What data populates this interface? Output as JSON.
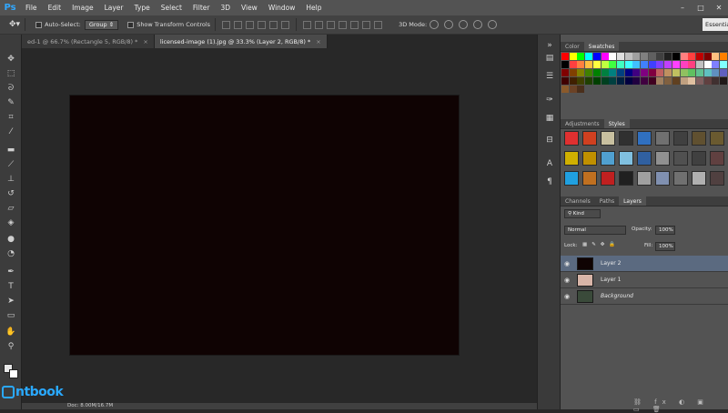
{
  "app": {
    "logo": "Ps"
  },
  "menu": [
    "File",
    "Edit",
    "Image",
    "Layer",
    "Type",
    "Select",
    "Filter",
    "3D",
    "View",
    "Window",
    "Help"
  ],
  "window_controls": [
    "–",
    "□",
    "✕"
  ],
  "options": {
    "auto_select_label": "Auto-Select:",
    "auto_select_value": "Group",
    "transform_label": "Show Transform Controls",
    "mode_label": "3D Mode:",
    "workspace": "Essentials"
  },
  "tabs": [
    {
      "label": "ed-1 @ 66.7% (Rectangle 5, RGB/8) *",
      "close": "×",
      "active": false
    },
    {
      "label": "licensed-image (1).jpg @ 33.3% (Layer 2, RGB/8) *",
      "close": "×",
      "active": true
    }
  ],
  "status": {
    "text": "Doc: 8.00M/16.7M"
  },
  "colors": {
    "canvas": "#0f0303",
    "accent": "#31a8ff",
    "selection": "#5b6a80"
  },
  "tools": [
    "move-icon",
    "marquee-icon",
    "lasso-icon",
    "quick-select-icon",
    "crop-icon",
    "eyedropper-icon",
    "healing-icon",
    "brush-icon",
    "stamp-icon",
    "history-brush-icon",
    "eraser-icon",
    "paint-bucket-icon",
    "blur-icon",
    "dodge-icon",
    "pen-icon",
    "type-icon",
    "path-select-icon",
    "shape-icon",
    "hand-icon",
    "zoom-icon"
  ],
  "swatch_panel": {
    "tabs": [
      "Color",
      "Swatches"
    ],
    "active": 1
  },
  "styles_panel": {
    "tabs": [
      "Adjustments",
      "Styles"
    ],
    "active": 1
  },
  "layers_panel": {
    "tabs": [
      "Channels",
      "Paths",
      "Layers"
    ],
    "active": 2,
    "filter": "Kind",
    "blend_mode": "Normal",
    "opacity_label": "Opacity:",
    "opacity": "100%",
    "lock_label": "Lock:",
    "fill_label": "Fill:",
    "fill": "100%",
    "layers": [
      {
        "name": "Layer 2",
        "selected": true,
        "thumb": "#0f0303"
      },
      {
        "name": "Layer 1",
        "selected": false,
        "thumb": "#d8b5a8"
      },
      {
        "name": "Background",
        "selected": false,
        "thumb": "#3a4a3a"
      }
    ]
  },
  "watermark": "ntbook"
}
